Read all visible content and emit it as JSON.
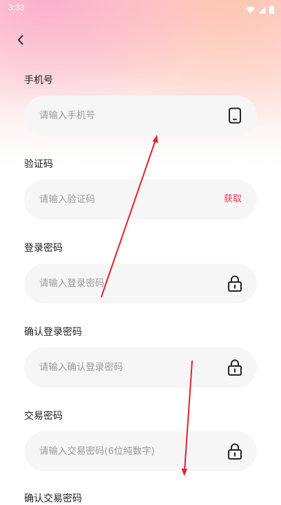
{
  "status_bar": {
    "time": "3:33",
    "icons": [
      "wifi-icon",
      "cellular-signal-icon",
      "battery-icon"
    ]
  },
  "header": {
    "back_icon": "chevron-left-icon"
  },
  "form": {
    "phone": {
      "label": "手机号",
      "placeholder": "请输入手机号",
      "icon": "phone-icon"
    },
    "code": {
      "label": "验证码",
      "placeholder": "请输入验证码",
      "get_code_label": "获取"
    },
    "login_password": {
      "label": "登录密码",
      "placeholder": "请输入登录密码",
      "icon": "lock-icon"
    },
    "confirm_login_password": {
      "label": "确认登录密码",
      "placeholder": "请输入确认登录密码",
      "icon": "lock-icon"
    },
    "trade_password": {
      "label": "交易密码",
      "placeholder": "请输入交易密码(6位纯数字)",
      "icon": "lock-icon"
    },
    "confirm_trade_password": {
      "label": "确认交易密码"
    }
  },
  "colors": {
    "accent": "#e8384a",
    "field_bg": "#f6f6f7",
    "annotation": "#e02030"
  }
}
